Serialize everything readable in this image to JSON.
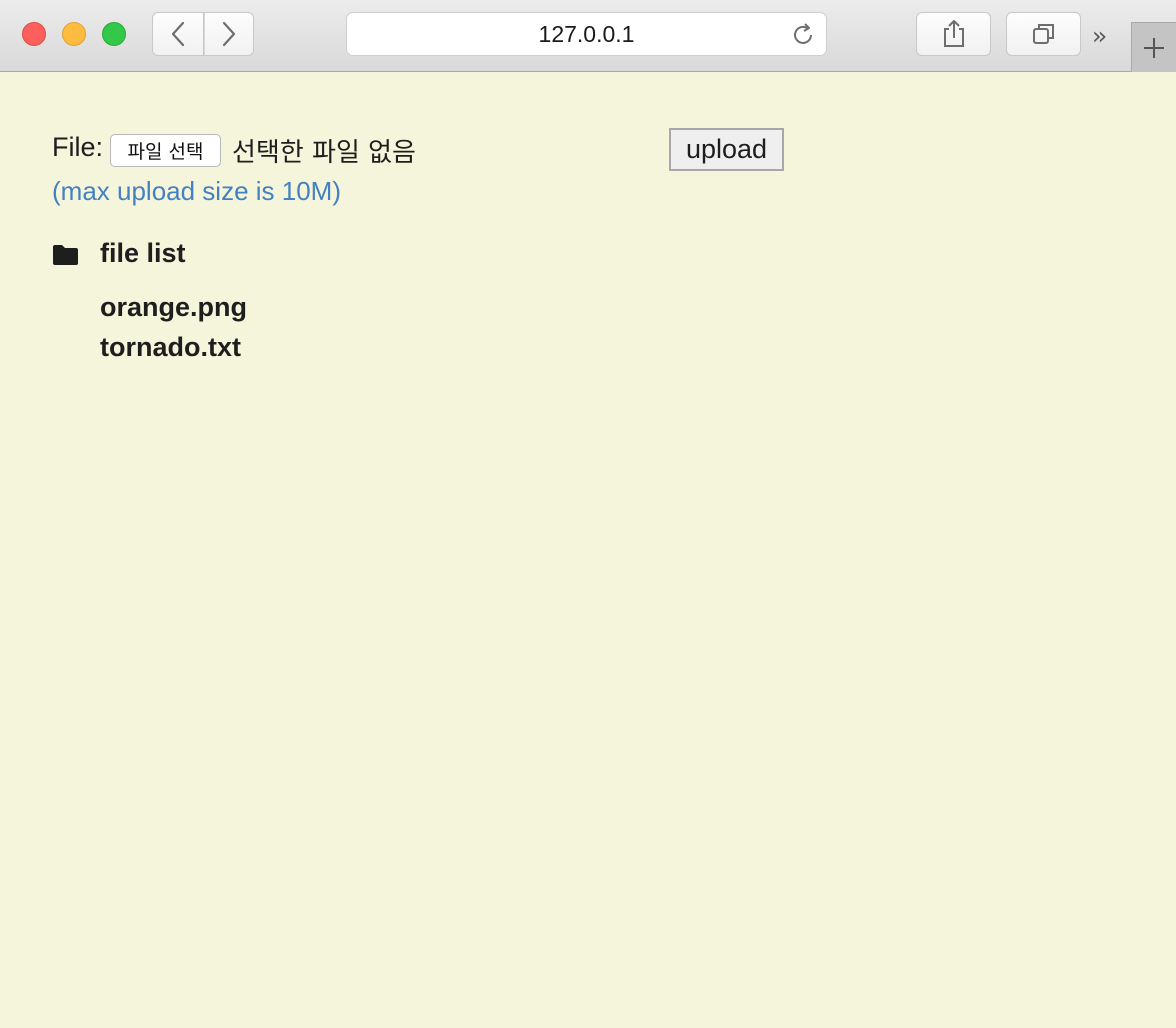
{
  "browser": {
    "url": "127.0.0.1",
    "icons": {
      "back": "chevron-left-icon",
      "forward": "chevron-right-icon",
      "reload": "reload-icon",
      "share": "share-icon",
      "tabs": "tabs-overview-icon",
      "overflow": "double-chevron-right-icon",
      "new_tab": "plus-icon"
    }
  },
  "form": {
    "file_label": "File:",
    "choose_button": "파일 선택",
    "no_file_text": "선택한 파일 없음",
    "upload_button": "upload",
    "max_size_note": "(max upload size is 10M)"
  },
  "file_list": {
    "icon": "folder-icon",
    "title": "file list",
    "items": [
      "orange.png",
      "tornado.txt"
    ]
  },
  "colors": {
    "background": "#f5f5dc",
    "note_text": "#4481c0"
  }
}
